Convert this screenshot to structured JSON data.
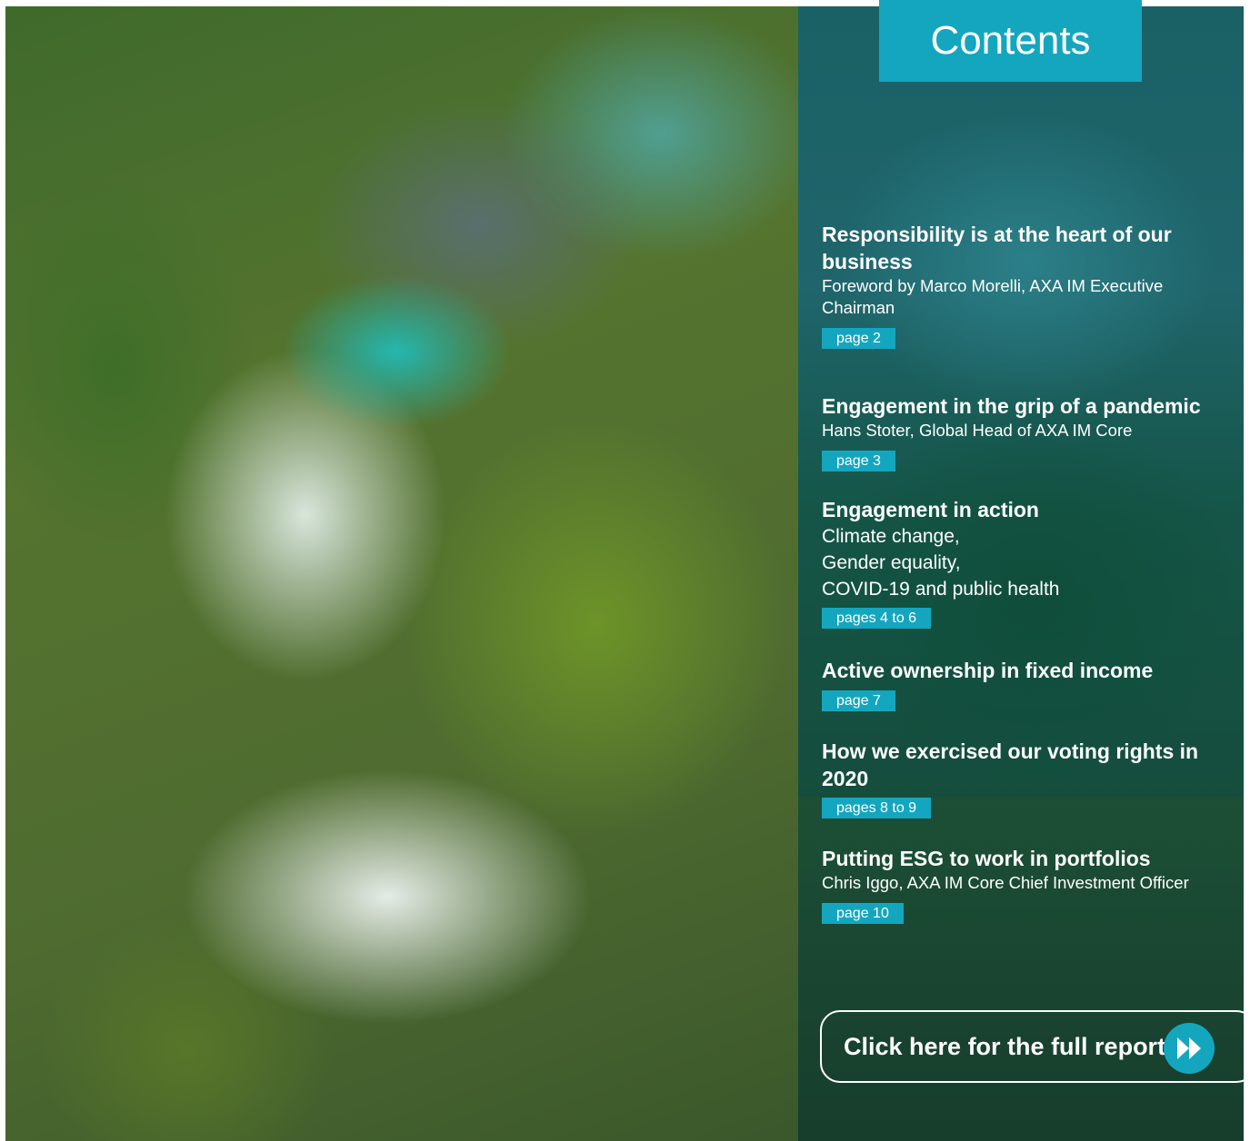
{
  "contents_tab": {
    "title": "Contents"
  },
  "items": [
    {
      "title": "Responsibility is at the heart of our business",
      "subtitle": "Foreword by Marco Morelli, AXA IM Executive Chairman",
      "page": "page 2"
    },
    {
      "title": "Engagement in the grip of a pandemic",
      "subtitle": "Hans Stoter, Global Head of AXA IM Core",
      "page": "page 3"
    },
    {
      "title": "Engagement in action",
      "lines": [
        "Climate change,",
        "Gender equality,",
        "COVID-19 and public health"
      ],
      "page": "pages 4 to 6"
    },
    {
      "title": "Active ownership in fixed income",
      "page": "page  7"
    },
    {
      "title": "How we exercised our voting rights in 2020",
      "page": "pages 8 to 9"
    },
    {
      "title": "Putting ESG to work in portfolios",
      "subtitle": "Chris Iggo, AXA IM Core Chief Investment Officer",
      "page": "page 10"
    }
  ],
  "cta": {
    "label": "Click here for the full report",
    "icon": "fast-forward-icon"
  },
  "colors": {
    "accent": "#14a6bf",
    "text": "#ffffff"
  }
}
